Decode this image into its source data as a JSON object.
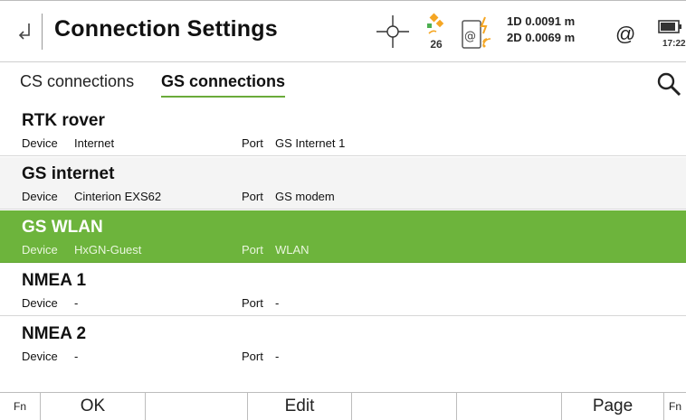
{
  "header": {
    "title": "Connection Settings",
    "satellites": "26",
    "accuracy_1d": "1D 0.0091 m",
    "accuracy_2d": "2D 0.0069 m",
    "at_symbol": "@",
    "time": "17:22"
  },
  "tabs": [
    {
      "label": "CS connections"
    },
    {
      "label": "GS connections",
      "active": true
    }
  ],
  "labels": {
    "device": "Device",
    "port": "Port"
  },
  "connections": [
    {
      "name": "RTK rover",
      "device": "Internet",
      "port": "GS Internet 1"
    },
    {
      "name": "GS internet",
      "device": "Cinterion EXS62",
      "port": "GS modem"
    },
    {
      "name": "GS WLAN",
      "device": "HxGN-Guest",
      "port": "WLAN",
      "selected": true
    },
    {
      "name": "NMEA 1",
      "device": "-",
      "port": "-"
    },
    {
      "name": "NMEA 2",
      "device": "-",
      "port": "-"
    }
  ],
  "softkeys": {
    "fn_left": "Fn",
    "ok": "OK",
    "f2": "",
    "edit": "Edit",
    "f4": "",
    "f5": "",
    "page": "Page",
    "fn_right": "Fn"
  },
  "colors": {
    "selected_row": "#6db43c",
    "tab_underline": "#6aab3a",
    "satellite_accent": "#f5a623"
  },
  "icons": {
    "back": "back-arrow-icon",
    "crosshair": "crosshair-icon",
    "satellite": "satellite-icon",
    "device": "device-status-icon",
    "battery": "battery-icon",
    "search": "search-icon"
  }
}
